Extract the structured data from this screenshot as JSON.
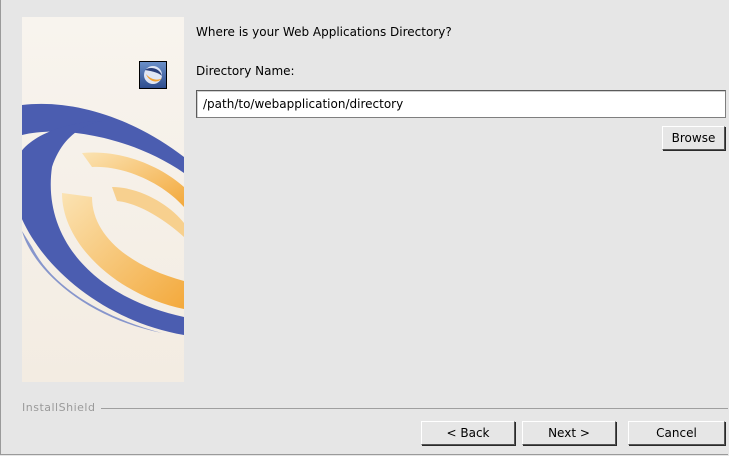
{
  "header": {
    "question": "Where is your Web Applications Directory?"
  },
  "form": {
    "field_label": "Directory Name:",
    "directory_value": "/path/to/webapplication/directory",
    "browse_label": "Browse"
  },
  "footer": {
    "brand": "InstallShield",
    "back_label": "< Back",
    "next_label": "Next >",
    "cancel_label": "Cancel"
  },
  "icons": {
    "logo": "installshield-logo-icon",
    "banner": "swoosh-banner-graphic"
  },
  "colors": {
    "background": "#e6e6e6",
    "banner_background": "#f6f1e9",
    "swoosh_blue": "#4a5fb0",
    "swoosh_orange": "#f6b24a"
  }
}
